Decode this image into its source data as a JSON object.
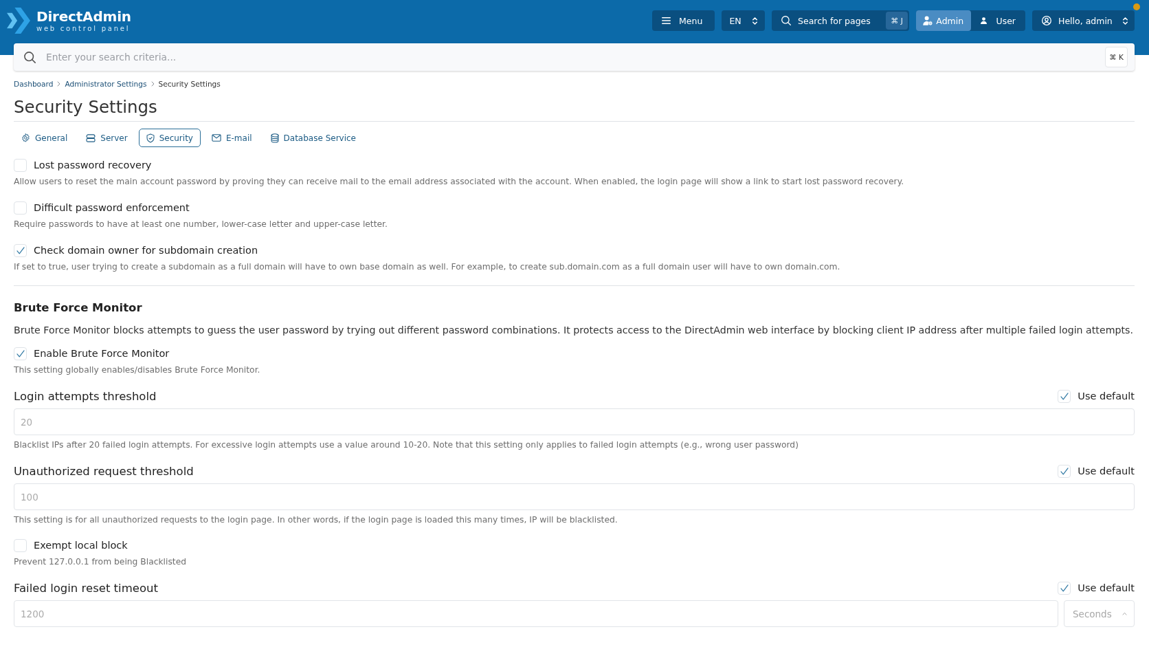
{
  "header": {
    "logo": {
      "name": "DirectAdmin",
      "tagline": "web control panel"
    },
    "menu_button": "Menu",
    "language": "EN",
    "page_search": {
      "label": "Search for pages",
      "shortcut": "⌘ J"
    },
    "role_switch": [
      {
        "label": "Admin",
        "selected": true
      },
      {
        "label": "User",
        "selected": false
      }
    ],
    "user_menu": "Hello, admin",
    "notification": true
  },
  "search": {
    "placeholder": "Enter your search criteria...",
    "shortcut": "⌘ K"
  },
  "breadcrumb": [
    "Dashboard",
    "Administrator Settings",
    "Security Settings"
  ],
  "title": "Security Settings",
  "tabs": [
    {
      "label": "General",
      "selected": false
    },
    {
      "label": "Server",
      "selected": false
    },
    {
      "label": "Security",
      "selected": true
    },
    {
      "label": "E-mail",
      "selected": false
    },
    {
      "label": "Database Service",
      "selected": false
    }
  ],
  "settings": [
    {
      "kind": "checkbox",
      "label": "Lost password recovery",
      "checked": false,
      "description": "Allow users to reset the main account password by proving they can receive mail to the email address associated with the account. When enabled, the login page will show a link to start lost password recovery."
    },
    {
      "kind": "checkbox",
      "label": "Difficult password enforcement",
      "checked": false,
      "description": "Require passwords to have at least one number, lower-case letter and upper-case letter."
    },
    {
      "kind": "checkbox",
      "label": "Check domain owner for subdomain creation",
      "checked": true,
      "description": "If set to true, user trying to create a subdomain as a full domain will have to own base domain as well. For example, to create sub.domain.com as a full domain user will have to own domain.com."
    }
  ],
  "brute_force": {
    "heading": "Brute Force Monitor",
    "intro": "Brute Force Monitor blocks attempts to guess the user password by trying out different password combinations. It protects access to the DirectAdmin web interface by blocking client IP address after multiple failed login attempts.",
    "settings": [
      {
        "kind": "checkbox",
        "label": "Enable Brute Force Monitor",
        "checked": true,
        "description": "This setting globally enables/disables Brute Force Monitor."
      },
      {
        "kind": "number",
        "label": "Login attempts threshold",
        "use_default": {
          "label": "Use default",
          "checked": true
        },
        "placeholder": "20",
        "description": "Blacklist IPs after 20 failed login attempts. For excessive login attempts use a value around 10-20. Note that this setting only applies to failed login attempts (e.g., wrong user password)"
      },
      {
        "kind": "number",
        "label": "Unauthorized request threshold",
        "use_default": {
          "label": "Use default",
          "checked": true
        },
        "placeholder": "100",
        "description": "This setting is for all unauthorized requests to the login page. In other words, if the login page is loaded this many times, IP will be blacklisted."
      },
      {
        "kind": "checkbox",
        "label": "Exempt local block",
        "checked": false,
        "description": "Prevent 127.0.0.1 from being Blacklisted"
      },
      {
        "kind": "number_unit",
        "label": "Failed login reset timeout",
        "use_default": {
          "label": "Use default",
          "checked": true
        },
        "placeholder": "1200",
        "unit": "Seconds"
      }
    ]
  }
}
